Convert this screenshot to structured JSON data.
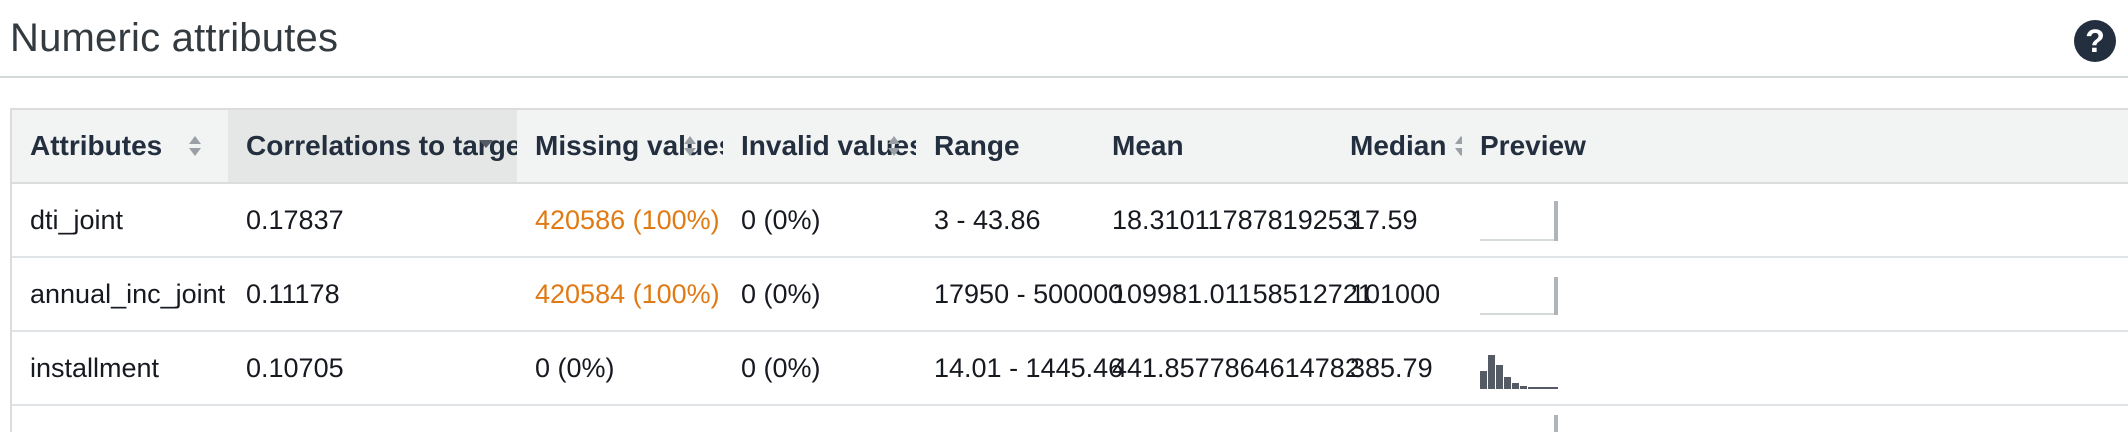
{
  "section": {
    "title": "Numeric attributes",
    "help_icon": "question-circle-icon",
    "help_glyph": "?"
  },
  "table": {
    "columns": [
      {
        "label": "Attributes",
        "sortable": true,
        "sorted": false
      },
      {
        "label": "Correlations to target *",
        "sortable": true,
        "sorted": true,
        "direction": "descending"
      },
      {
        "label": "Missing values",
        "sortable": true,
        "sorted": false
      },
      {
        "label": "Invalid values",
        "sortable": true,
        "sorted": false
      },
      {
        "label": "Range",
        "sortable": true,
        "sorted": false
      },
      {
        "label": "Mean",
        "sortable": true,
        "sorted": false
      },
      {
        "label": "Median",
        "sortable": true,
        "sorted": false
      },
      {
        "label": "Preview",
        "sortable": false,
        "sorted": false
      }
    ],
    "rows": [
      {
        "attribute": "dti_joint",
        "correlation": "0.17837",
        "missing": "420586 (100%)",
        "missing_warn": true,
        "invalid": "0 (0%)",
        "range": "3 - 43.86",
        "mean": "18.31011787819253",
        "median": "17.59",
        "preview": "histogram-icon"
      },
      {
        "attribute": "annual_inc_joint",
        "correlation": "0.11178",
        "missing": "420584 (100%)",
        "missing_warn": true,
        "invalid": "0 (0%)",
        "range": "17950 - 500000",
        "mean": "109981.01158512721",
        "median": "101000",
        "preview": "histogram-icon"
      },
      {
        "attribute": "installment",
        "correlation": "0.10705",
        "missing": "0 (0%)",
        "missing_warn": false,
        "invalid": "0 (0%)",
        "range": "14.01 - 1445.46",
        "mean": "441.8577864614782",
        "median": "385.79",
        "preview": "histogram-icon"
      }
    ]
  },
  "colors": {
    "warning_text": "#e07a14",
    "header_bg": "#f2f3f3",
    "sorted_header_bg": "#e5e6e6",
    "help_icon_bg": "#232f3e"
  }
}
